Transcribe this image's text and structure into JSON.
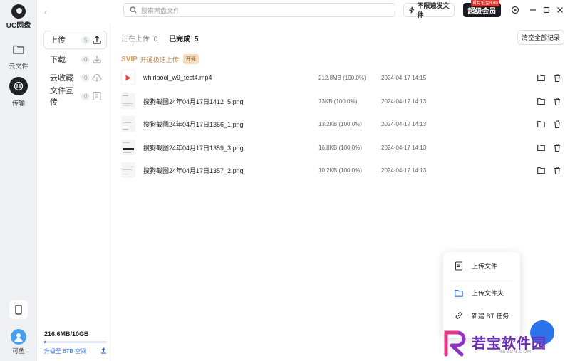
{
  "app": {
    "logo_text": "UC网盘"
  },
  "rail": {
    "items": [
      {
        "label": "云文件",
        "icon": "folder-icon"
      },
      {
        "label": "传输",
        "icon": "transfer-icon"
      }
    ],
    "bottom": {
      "device_icon": "phone-icon",
      "user_label": "可鱼"
    }
  },
  "sidebar": {
    "items": [
      {
        "label": "上传",
        "count": "5",
        "icon": "upload-icon"
      },
      {
        "label": "下载",
        "count": "0",
        "icon": "download-icon"
      },
      {
        "label": "云收藏",
        "count": "0",
        "icon": "cloud-save-icon"
      },
      {
        "label": "文件互传",
        "count": "0",
        "icon": "file-share-icon"
      }
    ],
    "storage": {
      "text": "216.6MB/10GB",
      "used_fraction": 0.0212,
      "upgrade_label": "升级至 6TB 空间"
    }
  },
  "topbar": {
    "search_placeholder": "搜索网盘文件",
    "speed_label": "不限速发文件",
    "vip_label": "超级会员",
    "vip_promo": "首月低至8.80"
  },
  "main": {
    "tabs": [
      {
        "label": "正在上传",
        "count": "0"
      },
      {
        "label": "已完成",
        "count": "5"
      }
    ],
    "clear_label": "清空全部记录",
    "promo": {
      "badge": "SVIP",
      "text": "开通极速上传",
      "button": "开通"
    },
    "files": [
      {
        "name": "whirlpool_w9_test4.mp4",
        "size": "212.8MB (100.0%)",
        "date": "2024-04-17 14:15",
        "type": "video"
      },
      {
        "name": "搜狗截图24年04月17日1412_5.png",
        "size": "73KB (100.0%)",
        "date": "2024-04-17 14:13",
        "type": "image"
      },
      {
        "name": "搜狗截图24年04月17日1356_1.png",
        "size": "13.2KB (100.0%)",
        "date": "2024-04-17 14:13",
        "type": "image"
      },
      {
        "name": "搜狗截图24年04月17日1359_3.png",
        "size": "16.8KB (100.0%)",
        "date": "2024-04-17 14:13",
        "type": "image"
      },
      {
        "name": "搜狗截图24年04月17日1357_2.png",
        "size": "10.2KB (100.0%)",
        "date": "2024-04-17 14:13",
        "type": "image"
      }
    ]
  },
  "popup": {
    "items": [
      {
        "label": "上传文件",
        "icon": "file-icon"
      },
      {
        "label": "上传文件夹",
        "icon": "folder-icon"
      },
      {
        "label": "新建 BT 任务",
        "icon": "link-icon"
      }
    ]
  },
  "watermark": {
    "text": "若宝软件园",
    "sub": "RBSGN.COM"
  },
  "colors": {
    "accent": "#2b73ea",
    "promo": "#e39a52",
    "vip_bg": "#1c1c22",
    "video_red": "#e5473f"
  }
}
